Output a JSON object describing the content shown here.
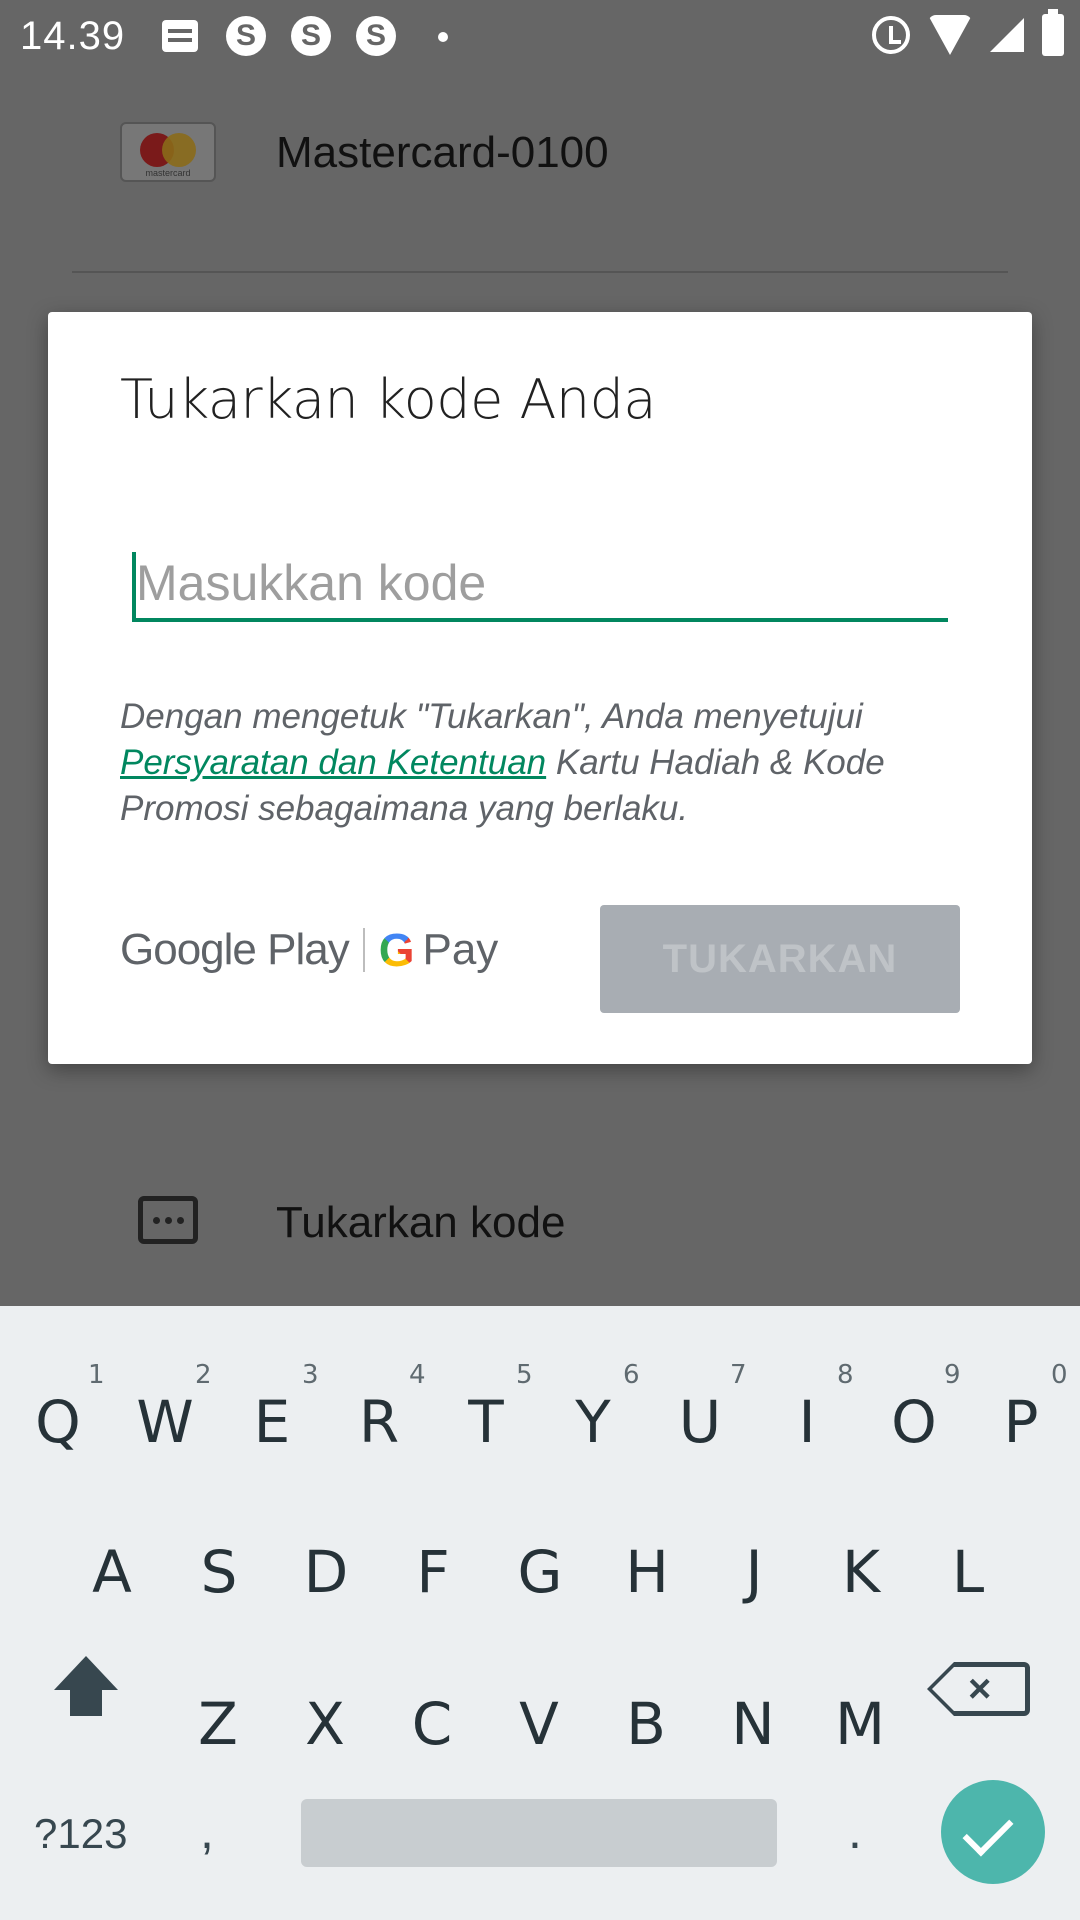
{
  "status_bar": {
    "time": "14.39",
    "skype_glyph": "S",
    "icons": [
      "message-icon",
      "skype-icon",
      "skype-icon",
      "skype-icon",
      "dot-icon",
      "alarm-icon",
      "wifi-icon",
      "signal-icon",
      "battery-icon"
    ]
  },
  "background": {
    "card": {
      "logo_text": "mastercard",
      "name": "Mastercard-0100"
    },
    "redeem_item": {
      "label": "Tukarkan kode"
    }
  },
  "dialog": {
    "title": "Tukarkan kode Anda",
    "code_input": {
      "value": "",
      "placeholder": "Masukkan kode"
    },
    "terms": {
      "prefix": "Dengan mengetuk \"Tukarkan\", Anda menyetujui",
      "link": "Persyaratan dan Ketentuan",
      "suffix": "Kartu Hadiah & Kode Promosi sebagaimana yang berlaku."
    },
    "brand": {
      "google_play": "Google Play",
      "g": "G",
      "pay": "Pay"
    },
    "redeem_button": "TUKARKAN"
  },
  "keyboard": {
    "row1": [
      "Q",
      "W",
      "E",
      "R",
      "T",
      "Y",
      "U",
      "I",
      "O",
      "P"
    ],
    "row1_hints": [
      "1",
      "2",
      "3",
      "4",
      "5",
      "6",
      "7",
      "8",
      "9",
      "0"
    ],
    "row2": [
      "A",
      "S",
      "D",
      "F",
      "G",
      "H",
      "J",
      "K",
      "L"
    ],
    "row3": [
      "Z",
      "X",
      "C",
      "V",
      "B",
      "N",
      "M"
    ],
    "symbols": "?123",
    "comma": ",",
    "period": ".",
    "backspace_glyph": "×"
  },
  "colors": {
    "accent": "#01875f",
    "overlay": "#666666",
    "button_disabled": "#a8adb3",
    "enter_key": "#4db6ac",
    "keyboard_bg": "#eceff1"
  }
}
